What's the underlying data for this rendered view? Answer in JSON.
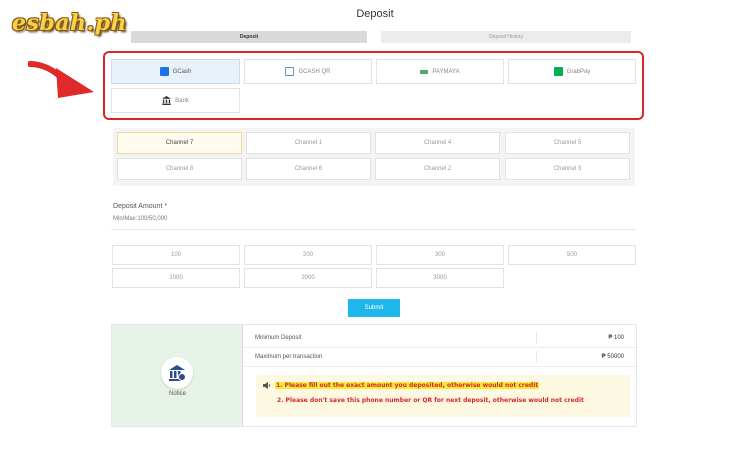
{
  "logo": "esbah.ph",
  "page_title": "Deposit",
  "tabs": [
    {
      "label": "Deposit"
    },
    {
      "label": "Deposit History"
    }
  ],
  "methods": [
    {
      "label": "GCash",
      "icon": "gcash-icon",
      "color": "#1a73e8"
    },
    {
      "label": "GCASH QR",
      "icon": "qr-icon",
      "color": "#6c8fb8"
    },
    {
      "label": "PAYMAYA",
      "icon": "paymaya-icon",
      "color": "#4aa564"
    },
    {
      "label": "GrabPay",
      "icon": "grabpay-icon",
      "color": "#00b14f"
    },
    {
      "label": "Bank",
      "icon": "bank-icon",
      "color": "#333333"
    }
  ],
  "channels": [
    "Channel 7",
    "Channel 1",
    "Channel 4",
    "Channel 5",
    "Channel 8",
    "Channel 6",
    "Channel 2",
    "Channel 3"
  ],
  "amount": {
    "label": "Deposit Amount",
    "required_mark": "*",
    "minmax": "Min/Max:100/50,000",
    "presets": [
      "100",
      "200",
      "300",
      "500",
      "1000",
      "2000",
      "3000"
    ]
  },
  "submit_label": "Submit",
  "notice": {
    "label": "Notice",
    "rows": [
      {
        "label": "Minimum Deposit",
        "value": "₱ 100"
      },
      {
        "label": "Maximum per transaction",
        "value": "₱ 50000"
      }
    ],
    "warnings": [
      "1. Please fill out the exact amount you deposited, otherwise would not credit",
      "2. Please don't save this phone number or QR for next deposit, otherwise would not credit"
    ]
  },
  "colors": {
    "highlight": "#d9262b",
    "submit": "#1fb7ea",
    "active_method": "#e8f0fa",
    "active_channel": "#fffbee"
  }
}
